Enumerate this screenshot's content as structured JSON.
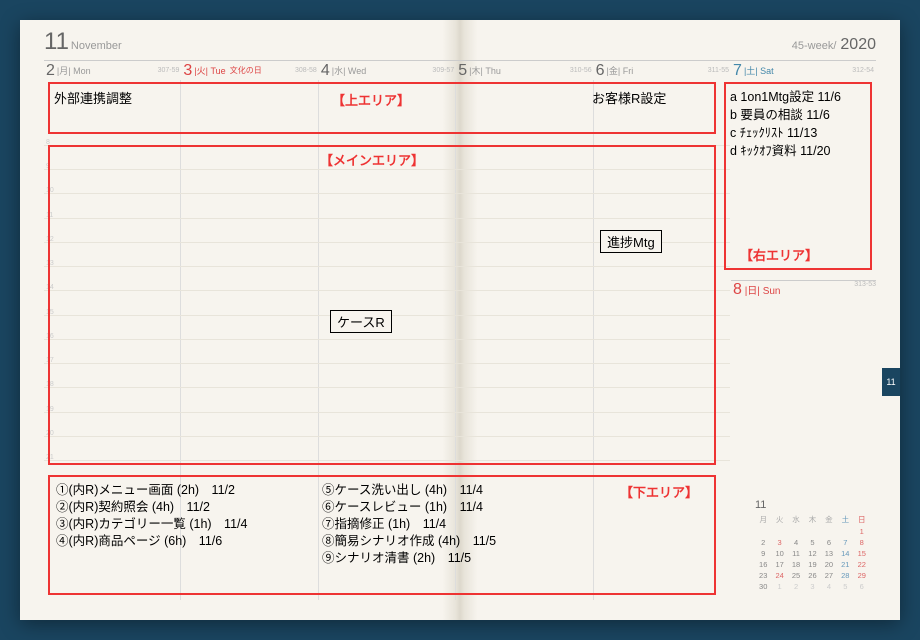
{
  "header": {
    "month_num": "11",
    "month_name": "November",
    "week_label": "45-week/",
    "year": "2020"
  },
  "days": [
    {
      "num": "2",
      "jp": "月",
      "en": "Mon",
      "tiny": "307-59"
    },
    {
      "num": "3",
      "jp": "火",
      "en": "Tue",
      "holiday": "文化の日",
      "tiny": "308-58",
      "red": true
    },
    {
      "num": "4",
      "jp": "水",
      "en": "Wed",
      "tiny": "309-57"
    },
    {
      "num": "5",
      "jp": "木",
      "en": "Thu",
      "tiny": "310-56"
    },
    {
      "num": "6",
      "jp": "金",
      "en": "Fri",
      "tiny": "311-55"
    },
    {
      "num": "7",
      "jp": "土",
      "en": "Sat",
      "tiny": "312-54",
      "blue": true
    }
  ],
  "sunday": {
    "num": "8",
    "jp": "日",
    "en": "Sun",
    "tiny": "313-53"
  },
  "hours": [
    "8",
    "9",
    "10",
    "11",
    "12",
    "13",
    "14",
    "15",
    "16",
    "17",
    "18",
    "19",
    "20",
    "21"
  ],
  "annotations": {
    "top_label": "【上エリア】",
    "main_label": "【メインエリア】",
    "right_label": "【右エリア】",
    "bottom_label": "【下エリア】"
  },
  "top_area": {
    "mon": "外部連携調整",
    "fri": "お客様R設定"
  },
  "right_tasks": [
    "a 1on1Mtg設定 11/6",
    "b 要員の相談 11/6",
    "c ﾁｪｯｸﾘｽﾄ 11/13",
    "d ｷｯｸｵﾌ資料 11/20"
  ],
  "events": {
    "case_r": "ケースR",
    "progress_mtg": "進捗Mtg"
  },
  "bottom_tasks_left": [
    "①(内R)メニュー画面 (2h)　11/2",
    "②(内R)契約照会 (4h)　11/2",
    "③(内R)カテゴリー一覧 (1h)　11/4",
    "④(内R)商品ページ (6h)　11/6"
  ],
  "bottom_tasks_right": [
    "⑤ケース洗い出し (4h)　11/4",
    "⑥ケースレビュー (1h)　11/4",
    "⑦指摘修正 (1h)　11/4",
    "⑧簡易シナリオ作成 (4h)　11/5",
    "⑨シナリオ清書 (2h)　11/5"
  ],
  "mini_cal": {
    "month": "11",
    "dow": [
      "月",
      "火",
      "水",
      "木",
      "金",
      "土",
      "日"
    ],
    "rows": [
      [
        "",
        "",
        "",
        "",
        "",
        "",
        "1"
      ],
      [
        "2",
        "3",
        "4",
        "5",
        "6",
        "7",
        "8"
      ],
      [
        "9",
        "10",
        "11",
        "12",
        "13",
        "14",
        "15"
      ],
      [
        "16",
        "17",
        "18",
        "19",
        "20",
        "21",
        "22"
      ],
      [
        "23",
        "24",
        "25",
        "26",
        "27",
        "28",
        "29"
      ],
      [
        "30",
        "1",
        "2",
        "3",
        "4",
        "5",
        "6"
      ]
    ]
  },
  "month_tab": "11"
}
